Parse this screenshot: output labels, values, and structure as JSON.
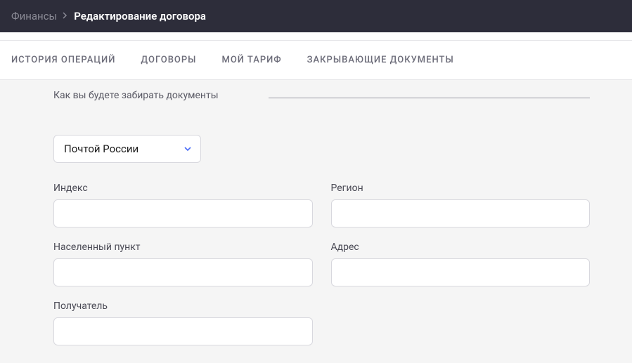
{
  "breadcrumb": {
    "parent": "Финансы",
    "current": "Редактирование договора"
  },
  "tabs": [
    {
      "label": "ИСТОРИЯ ОПЕРАЦИЙ"
    },
    {
      "label": "ДОГОВОРЫ"
    },
    {
      "label": "МОЙ ТАРИФ"
    },
    {
      "label": "ЗАКРЫВАЮЩИЕ ДОКУМЕНТЫ"
    }
  ],
  "section": {
    "title": "Как вы будете забирать документы"
  },
  "delivery": {
    "selected": "Почтой России"
  },
  "fields": {
    "index": {
      "label": "Индекс",
      "value": ""
    },
    "region": {
      "label": "Регион",
      "value": ""
    },
    "city": {
      "label": "Населенный пункт",
      "value": ""
    },
    "address": {
      "label": "Адрес",
      "value": ""
    },
    "recipient": {
      "label": "Получатель",
      "value": ""
    }
  },
  "colors": {
    "header_bg": "#2d2d3a",
    "accent": "#4a6cf7"
  }
}
